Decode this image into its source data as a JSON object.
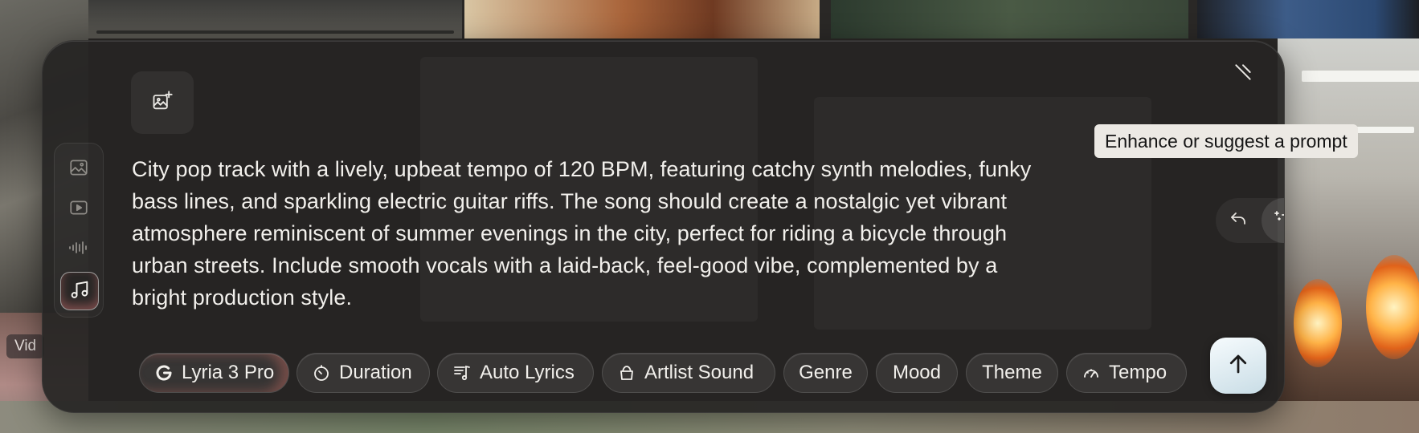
{
  "background": {
    "video_tag": "Vid"
  },
  "panel": {
    "icons": {
      "add_media": "image-plus-icon",
      "collapse": "collapse-icon"
    },
    "modes": [
      {
        "name": "image",
        "icon": "image-icon",
        "active": false
      },
      {
        "name": "video",
        "icon": "play-icon",
        "active": false
      },
      {
        "name": "audio",
        "icon": "waveform-icon",
        "active": false
      },
      {
        "name": "music",
        "icon": "music-note-icon",
        "active": true
      }
    ],
    "prompt": "City pop track with a lively, upbeat tempo of 120 BPM, featuring catchy synth melodies, funky bass lines, and sparkling electric guitar riffs. The song should create a nostalgic yet vibrant atmosphere reminiscent of summer evenings in the city, perfect for riding a bicycle through urban streets. Include smooth vocals with a laid-back, feel-good vibe, complemented by a bright production style.",
    "tooltip": "Enhance or suggest a prompt",
    "chips": {
      "model": "Lyria 3 Pro",
      "duration": "Duration",
      "lyrics": "Auto Lyrics",
      "artist": "Artlist Sound",
      "genre": "Genre",
      "mood": "Mood",
      "theme": "Theme",
      "tempo": "Tempo"
    },
    "colors": {
      "panel_bg": "#262523",
      "text": "#f2f0ec",
      "send_button": "#e6f1f5",
      "tooltip_bg": "#ece9e4"
    }
  }
}
